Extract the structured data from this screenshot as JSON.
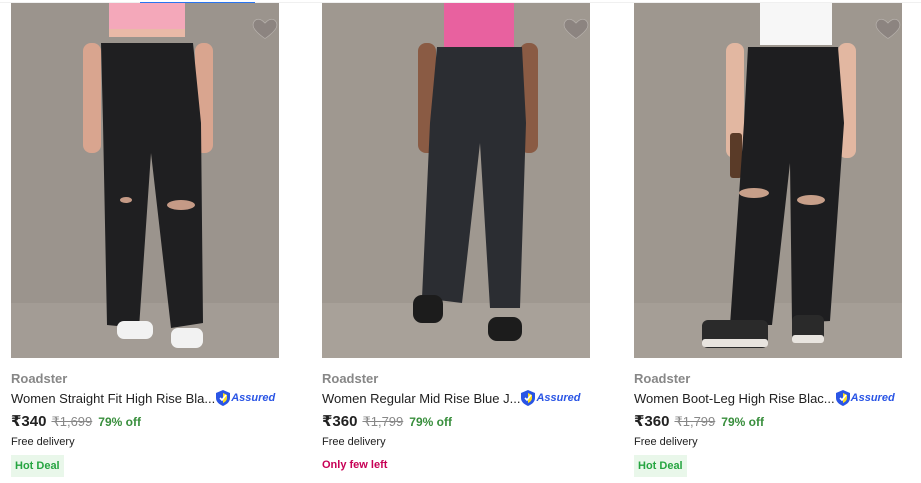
{
  "accent_color": "#2874f0",
  "products": [
    {
      "brand": "Roadster",
      "title": "Women Straight Fit High Rise Bla...",
      "assured_label": "Assured",
      "price": "₹340",
      "mrp": "₹1,699",
      "discount": "79% off",
      "delivery": "Free delivery",
      "badge": "Hot Deal",
      "top_color": "#f4a8ba",
      "shoe_color": "#f2f2f2",
      "wishlist_icon": "heart-icon"
    },
    {
      "brand": "Roadster",
      "title": "Women Regular Mid Rise Blue J...",
      "assured_label": "Assured",
      "price": "₹360",
      "mrp": "₹1,799",
      "discount": "79% off",
      "delivery": "Free delivery",
      "stock_note": "Only few left",
      "top_color": "#e8619f",
      "shoe_color": "#1c1c1c",
      "wishlist_icon": "heart-icon"
    },
    {
      "brand": "Roadster",
      "title": "Women Boot-Leg High Rise Blac...",
      "assured_label": "Assured",
      "price": "₹360",
      "mrp": "₹1,799",
      "discount": "79% off",
      "delivery": "Free delivery",
      "badge": "Hot Deal",
      "top_color": "#f7f7f7",
      "shoe_color": "#2a2a2a",
      "wishlist_icon": "heart-icon"
    }
  ]
}
